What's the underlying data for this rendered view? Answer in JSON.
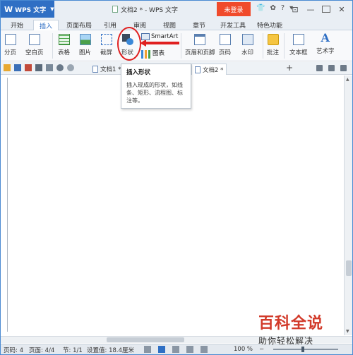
{
  "titlebar": {
    "app_button": "WPS 文字",
    "doc_title": "文档2 * - WPS 文字",
    "login": "未登录",
    "help": "?"
  },
  "menu": {
    "tabs": [
      "开始",
      "插入",
      "页面布局",
      "引用",
      "审阅",
      "视图",
      "章节",
      "开发工具",
      "特色功能"
    ],
    "active": "插入"
  },
  "ribbon": {
    "page_break": "分页",
    "blank_page": "空白页",
    "table": "表格",
    "picture": "图片",
    "screenshot": "截屏",
    "shape": "形状",
    "smartart": "SmartArt",
    "chart": "图表",
    "header_footer": "页眉和页脚",
    "page_number": "页码",
    "watermark": "水印",
    "comment": "批注",
    "text_box": "文本框",
    "wordart": "艺术字"
  },
  "doc_tabs": [
    {
      "label": "文档1 *"
    },
    {
      "label": "文档2 *"
    }
  ],
  "tooltip": {
    "title": "插入形状",
    "body": "插入现成的形状，如线条、矩形、流程图、标注等。"
  },
  "status": {
    "page": "页码: 4",
    "pages": "页面: 4/4",
    "section": "节: 1/1",
    "setting": "设置值: 18.4厘米",
    "zoom": "100 %"
  },
  "watermark": {
    "big": "百科全说",
    "small": "助你轻松解决"
  },
  "colors": {
    "accent": "#2f6fc4",
    "login": "#f04a2b",
    "highlight": "#e02020"
  }
}
